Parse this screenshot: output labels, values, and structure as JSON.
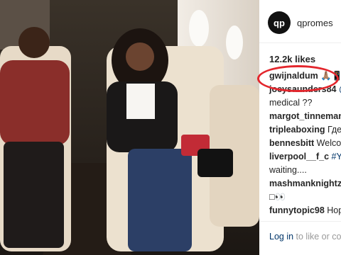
{
  "post": {
    "username": "qpromes",
    "avatar_text": "qp",
    "likes": "12.2k likes"
  },
  "comments": [
    {
      "user": "gwijnaldum",
      "text": " 🙏🏽📱"
    },
    {
      "user": "joeysaunders84",
      "text": " @"
    },
    {
      "user": "",
      "text": "medical ??"
    },
    {
      "user": "margot_tinnemans",
      "text": ""
    },
    {
      "user": "tripleaboxing",
      "text": " Где Д"
    },
    {
      "user": "bennesbitt",
      "text": " Welcom"
    },
    {
      "user": "liverpool__f_c",
      "text": " #YN"
    },
    {
      "user": "",
      "text": "waiting...."
    },
    {
      "user": "mashmanknightz",
      "text": " @"
    },
    {
      "user": "",
      "text": "□👀"
    },
    {
      "user": "funnytopic98",
      "text": " Hope"
    }
  ],
  "footer": {
    "login_link": "Log in",
    "login_text": " to like or com"
  },
  "colors": {
    "highlight_circle": "#e3262d",
    "link": "#003569"
  }
}
